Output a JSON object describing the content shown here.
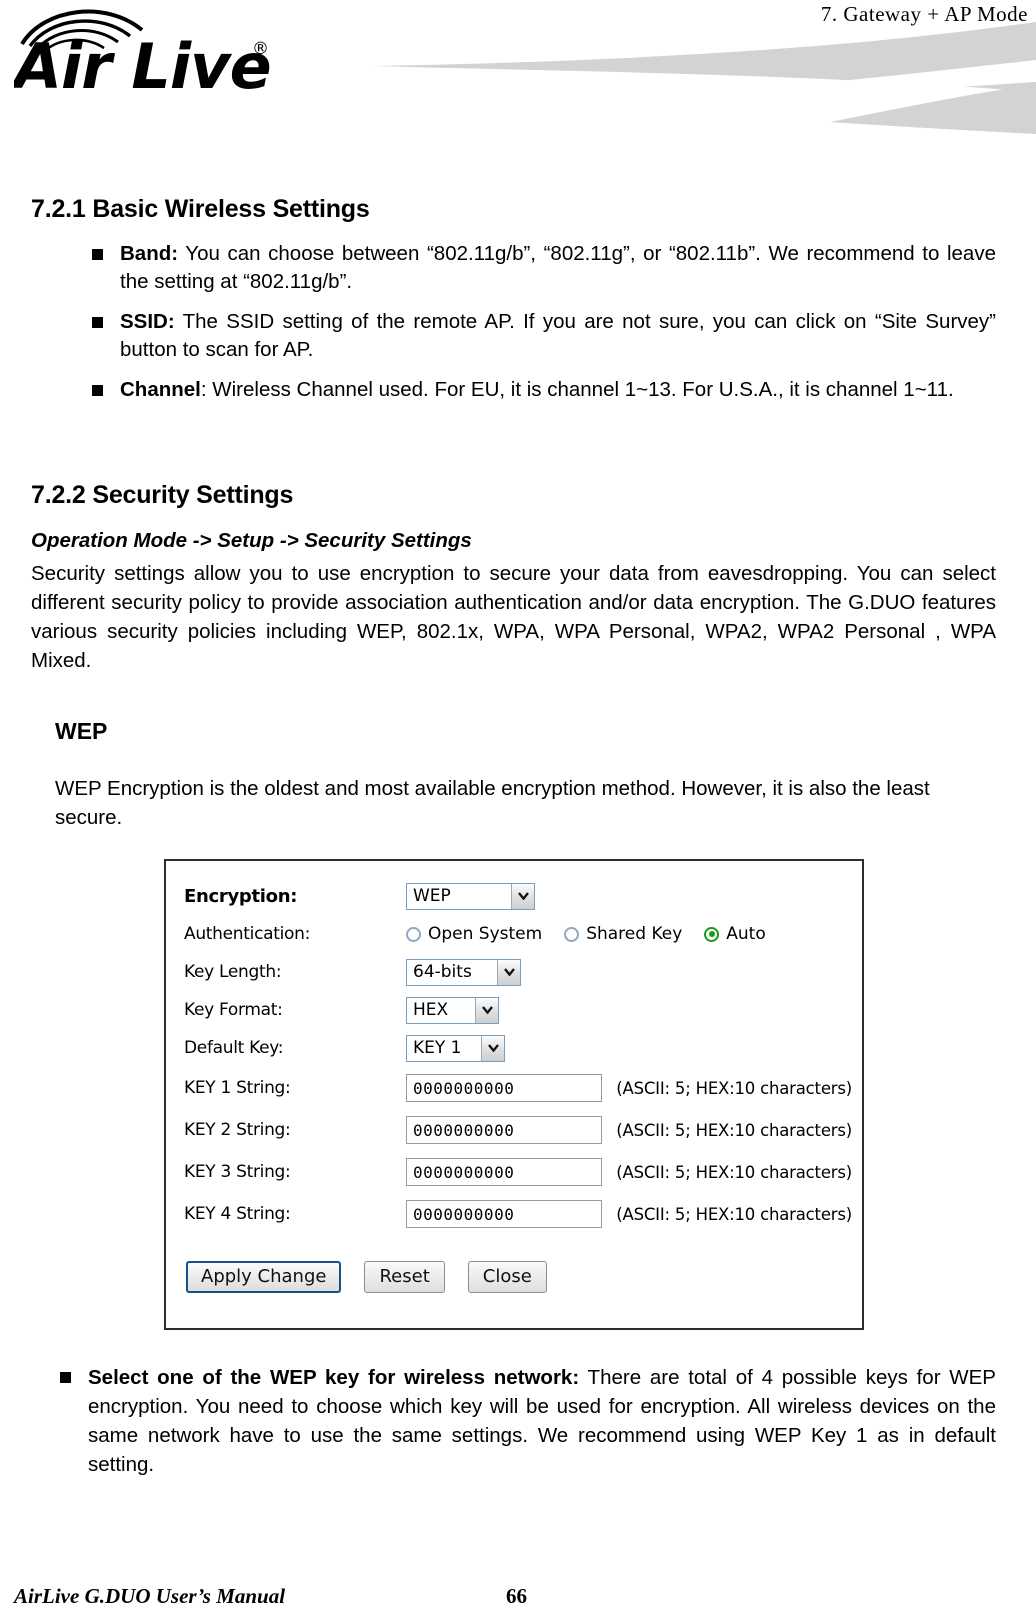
{
  "header": {
    "running_title": "7.  Gateway  +  AP   Mode",
    "logo_text": "Air Live",
    "logo_trademark": "®"
  },
  "sections": {
    "basic_wireless": {
      "number_title": "7.2.1 Basic Wireless Settings",
      "bullets": [
        {
          "term": "Band:",
          "text": "  You can choose between “802.11g/b”, “802.11g”, or “802.11b”.    We recommend to leave the setting at “802.11g/b”."
        },
        {
          "term": "SSID:",
          "text": "  The SSID setting of the remote AP.    If you are not sure, you can click on “Site Survey” button to scan for AP."
        },
        {
          "term": "Channel",
          "text": ":   Wireless Channel used.    For EU, it is channel 1~13.    For U.S.A., it is channel 1~11."
        }
      ]
    },
    "security": {
      "number_title": "7.2.2 Security Settings",
      "breadcrumb": "Operation Mode -> Setup -> Security Settings",
      "paragraph": "Security settings allow you to use encryption to secure your data from eavesdropping.  You can select different security policy to provide association authentication and/or data encryption.    The G.DUO features various security policies including WEP, 802.1x, WPA, WPA Personal, WPA2, WPA2 Personal , WPA Mixed."
    },
    "wep": {
      "heading": "WEP",
      "paragraph": "WEP Encryption is the oldest and most available encryption method.    However, it is also the least secure.",
      "bullets": [
        {
          "term": "Select one of the WEP key for wireless network:",
          "text": "   There are total of 4 possible keys for WEP encryption.    You need to choose which key will be used for encryption.    All wireless devices on the same network have to use the same settings.    We recommend using WEP Key 1 as in default setting."
        }
      ]
    }
  },
  "wep_form": {
    "encryption": {
      "label": "Encryption:",
      "value": "WEP"
    },
    "authentication": {
      "label": "Authentication:",
      "options": [
        {
          "label": "Open System",
          "checked": false
        },
        {
          "label": "Shared Key",
          "checked": false
        },
        {
          "label": "Auto",
          "checked": true
        }
      ]
    },
    "key_length": {
      "label": "Key Length:",
      "value": "64-bits"
    },
    "key_format": {
      "label": "Key Format:",
      "value": "HEX"
    },
    "default_key": {
      "label": "Default Key:",
      "value": "KEY 1"
    },
    "key_strings": [
      {
        "label": "KEY 1 String:",
        "value": "0000000000",
        "hint": "(ASCII: 5; HEX:10 characters)"
      },
      {
        "label": "KEY 2 String:",
        "value": "0000000000",
        "hint": "(ASCII: 5; HEX:10 characters)"
      },
      {
        "label": "KEY 3 String:",
        "value": "0000000000",
        "hint": "(ASCII: 5; HEX:10 characters)"
      },
      {
        "label": "KEY 4 String:",
        "value": "0000000000",
        "hint": "(ASCII: 5; HEX:10 characters)"
      }
    ],
    "buttons": {
      "apply": "Apply Change",
      "reset": "Reset",
      "close": "Close"
    }
  },
  "footer": {
    "manual_title": "AirLive G.DUO User’s Manual",
    "page_number": "66"
  }
}
